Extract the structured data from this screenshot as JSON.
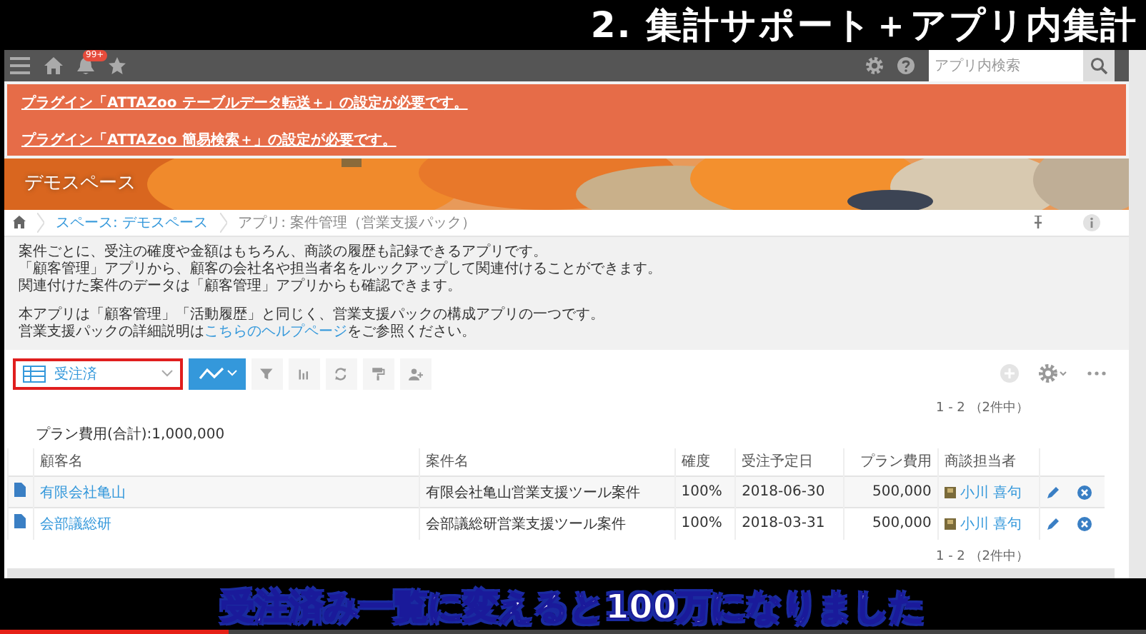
{
  "caption_title": "2. 集計サポート＋アプリ内集計",
  "header": {
    "notification_badge": "99+",
    "search": {
      "placeholder": "アプリ内検索"
    }
  },
  "alerts": [
    "プラグイン「ATTAZoo テーブルデータ転送＋」の設定が必要です。",
    "プラグイン「ATTAZoo 簡易検索＋」の設定が必要です。"
  ],
  "space_title": "デモスペース",
  "breadcrumbs": [
    {
      "text": "スペース: デモスペース",
      "link": true
    },
    {
      "text": "アプリ: 案件管理（営業支援パック）",
      "link": false
    }
  ],
  "description": [
    [
      "案件ごとに、受注の確度や金額はもちろん、商談の履歴も記録できるアプリです。",
      "「顧客管理」アプリから、顧客の会社名や担当者名をルックアップして関連付けることができます。",
      "関連付けた案件のデータは「顧客管理」アプリからも確認できます。"
    ],
    [
      "本アプリは「顧客管理」「活動履歴」と同じく、営業支援パックの構成アプリの一つです。"
    ]
  ],
  "help_line": {
    "before": "営業支援パックの詳細説明は",
    "link": "こちらのヘルプページ",
    "after": "をご参照ください。"
  },
  "view_select": "受注済",
  "count_top": "1 - 2 （2件中）",
  "sum": "プラン費用(合計):1,000,000",
  "table": {
    "columns": [
      "顧客名",
      "案件名",
      "確度",
      "受注予定日",
      "プラン費用",
      "商談担当者"
    ],
    "rows": [
      {
        "customer": "有限会社亀山",
        "deal": "有限会社亀山営業支援ツール案件",
        "probability": "100%",
        "date": "2018-06-30",
        "cost": "500,000",
        "owner": "小川 喜句"
      },
      {
        "customer": "会部議総研",
        "deal": "会部議総研営業支援ツール案件",
        "probability": "100%",
        "date": "2018-03-31",
        "cost": "500,000",
        "owner": "小川 喜句"
      }
    ]
  },
  "count_bottom": "1 - 2 （2件中）",
  "subtitle": "受注済み一覧に変えると100万になりました",
  "video_progress": {
    "level": 0.2
  }
}
